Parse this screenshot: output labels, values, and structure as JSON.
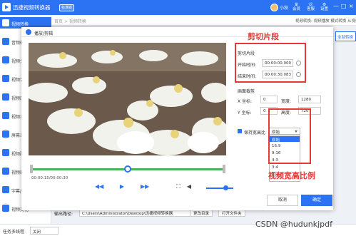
{
  "app": {
    "title": "迅捷视频转换器",
    "version_badge": "标准版",
    "user_name": "小秋",
    "top_right": [
      "会员",
      "客服",
      "设置",
      "—",
      "□",
      "×"
    ]
  },
  "sidebar": {
    "items": [
      {
        "label": "视频转换",
        "active": true
      },
      {
        "label": "音频转换",
        "active": false
      },
      {
        "label": "视频分割",
        "active": false
      },
      {
        "label": "视频合并",
        "active": false
      },
      {
        "label": "视频压缩",
        "active": false
      },
      {
        "label": "视频水印",
        "active": false
      },
      {
        "label": "屏幕录像",
        "active": false
      },
      {
        "label": "视频配乐",
        "active": false
      },
      {
        "label": "视频转GIF",
        "active": false
      },
      {
        "label": "字幕/贴图",
        "active": false
      },
      {
        "label": "视频美化",
        "active": false
      }
    ]
  },
  "breadcrumb": {
    "home": "首页",
    "sep": ">",
    "current": "视频转换",
    "right_text": "视频转换: 视频播放 模式转换 从视频转换"
  },
  "dialog": {
    "title": "播放/剪辑",
    "timecode": "00:00:15/00:00:30",
    "progress": 0.5,
    "volume": 0.7,
    "clip": {
      "heading": "剪切片段",
      "start_label": "开始时间:",
      "start_value": "00:00:00.000",
      "end_label": "结束时间:",
      "end_value": "00:00:30.083"
    },
    "crop": {
      "heading": "画面裁剪",
      "x_label": "X 坐标:",
      "x_value": "0",
      "width_label": "宽度:",
      "width_value": "1280",
      "y_label": "Y 坐标:",
      "y_value": "0",
      "height_label": "高度:",
      "height_value": "720"
    },
    "aspect": {
      "checkbox_label": "保持宽高比",
      "selected": "原始",
      "options": [
        "原始",
        "16:9",
        "9:16",
        "4:3",
        "3:4",
        "1:1"
      ]
    },
    "cancel_label": "取消",
    "ok_label": "确定"
  },
  "output": {
    "label": "输出路径:",
    "path": "C:\\Users\\Administrator\\Desktop\\迅捷视频转换器",
    "change_label": "更改目录",
    "open_label": "打开文件夹"
  },
  "bottom": {
    "task_label": "任务多线程",
    "task_value": "关闭"
  },
  "right_partial_label": "全部转换",
  "annotations": {
    "clip_note": "剪切片段",
    "ratio_note": "视频宽高比例"
  },
  "watermark": "CSDN @hudunkjpdf",
  "colors": {
    "brand": "#2b73f2",
    "annotation": "#e53935",
    "progress": "#48b35b"
  }
}
